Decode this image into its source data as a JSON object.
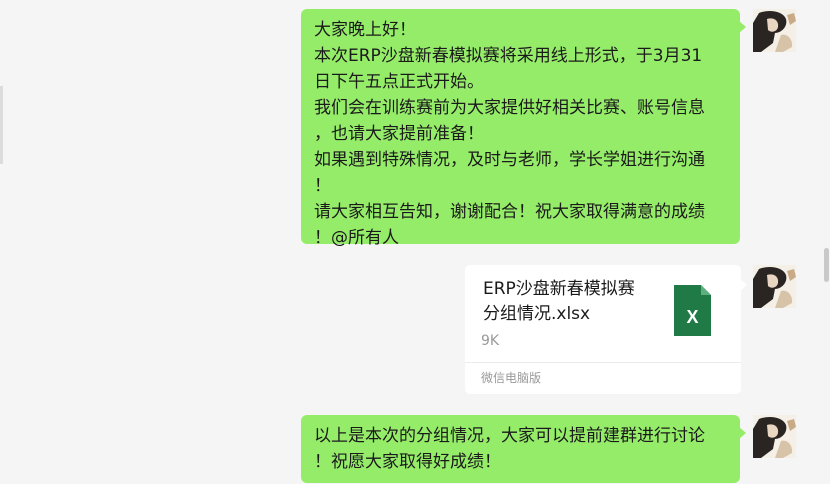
{
  "messages": [
    {
      "type": "text",
      "lines": [
        "大家晚上好！",
        "本次ERP沙盘新春模拟赛将采用线上形式，于3月31",
        "日下午五点正式开始。",
        "我们会在训练赛前为大家提供好相关比赛、账号信息",
        "，也请大家提前准备！",
        "如果遇到特殊情况，及时与老师，学长学姐进行沟通",
        "！",
        "请大家相互告知，谢谢配合！祝大家取得满意的成绩",
        "！@所有人"
      ]
    },
    {
      "type": "file",
      "name_lines": [
        "ERP沙盘新春模拟赛",
        "分组情况.xlsx"
      ],
      "size": "9K",
      "source": "微信电脑版",
      "icon": "xlsx-icon",
      "icon_letter": "X",
      "icon_color": "#1f7a45"
    },
    {
      "type": "text",
      "lines": [
        "以上是本次的分组情况，大家可以提前建群进行讨论",
        "！祝愿大家取得好成绩！"
      ]
    }
  ],
  "colors": {
    "bubble": "#95ec69",
    "background": "#f5f5f5",
    "file_card": "#ffffff"
  }
}
